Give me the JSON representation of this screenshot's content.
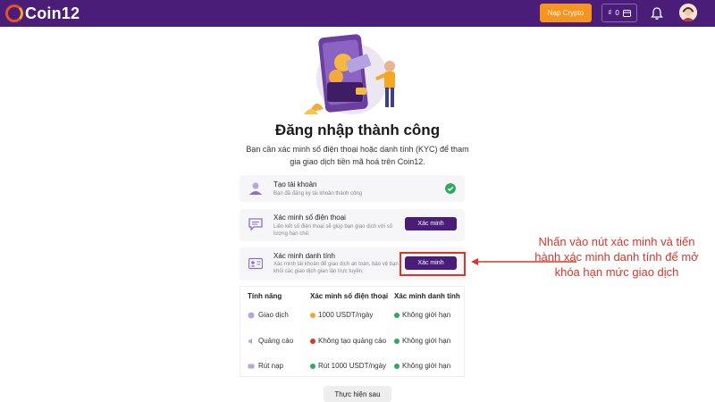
{
  "header": {
    "logo_text": "Coin12",
    "deposit_button": "Nạp Crypto",
    "wallet_balance": "0",
    "brand_color": "#4a1e78",
    "accent_color": "#f7941d"
  },
  "main": {
    "title": "Đăng nhập thành công",
    "subtitle": "Bạn cần xác minh số điện thoại hoặc danh tính (KYC) để tham gia giao dịch tiền mã hoá trên Coin12."
  },
  "steps": [
    {
      "title": "Tạo tài khoản",
      "desc": "Bạn đã đăng ký tài khoản thành công",
      "icon": "user-icon",
      "status": "done"
    },
    {
      "title": "Xác minh số điện thoại",
      "desc": "Liên kết số điện thoại sẽ giúp bạn giao dịch với số lượng hạn chế.",
      "icon": "chat-icon",
      "button": "Xác minh"
    },
    {
      "title": "Xác minh danh tính",
      "desc": "Xác minh tài khoản để giao dịch an toàn, bảo vệ bạn khỏi các giao dịch gian lận trực tuyến.",
      "icon": "id-card-icon",
      "button": "Xác minh"
    }
  ],
  "table": {
    "headers": [
      "Tính năng",
      "Xác minh số điện thoại",
      "Xác minh danh tính"
    ],
    "rows": [
      {
        "feature": "Giao dịch",
        "phone": "1000 USDT/ngày",
        "phone_status": "limited",
        "id": "Không giới hạn",
        "id_status": "ok"
      },
      {
        "feature": "Quảng cáo",
        "phone": "Không tạo quảng cáo",
        "phone_status": "no",
        "id": "Không giới hạn",
        "id_status": "ok"
      },
      {
        "feature": "Rút nạp",
        "phone": "Rút 1000 USDT/ngày",
        "phone_status": "ok",
        "id": "Không giới hạn",
        "id_status": "ok"
      }
    ]
  },
  "later_button": "Thực hiện sau",
  "annotation": "Nhấn vào nút xác minh và tiến hành xác minh danh tính để mở khóa hạn mức giao dịch"
}
